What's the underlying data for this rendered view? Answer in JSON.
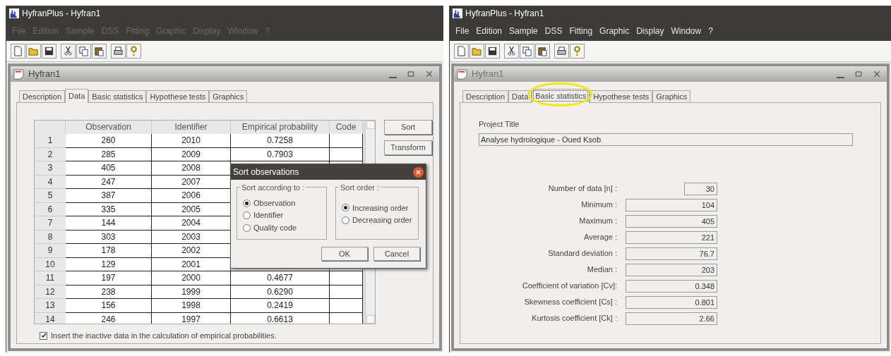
{
  "windows": [
    {
      "title": "HyfranPlus - Hyfran1",
      "menu": [
        {
          "label": "File",
          "disabled": true
        },
        {
          "label": "Edition",
          "disabled": true
        },
        {
          "label": "Sample",
          "disabled": true
        },
        {
          "label": "DSS",
          "disabled": true
        },
        {
          "label": "Fitting",
          "disabled": true
        },
        {
          "label": "Graphic",
          "disabled": true
        },
        {
          "label": "Display",
          "disabled": true
        },
        {
          "label": "Window",
          "disabled": true
        },
        {
          "label": "?",
          "disabled": true
        }
      ],
      "child_window": {
        "title": "Hyfran1",
        "active": true
      },
      "tabs": [
        {
          "label": "Description",
          "selected": false,
          "highlighted": false
        },
        {
          "label": "Data",
          "selected": true,
          "highlighted": false
        },
        {
          "label": "Basic statistics",
          "selected": false,
          "highlighted": false
        },
        {
          "label": "Hypothese tests",
          "selected": false,
          "highlighted": false
        },
        {
          "label": "Graphics",
          "selected": false,
          "highlighted": false
        }
      ],
      "content": {
        "kind": "data",
        "table": {
          "columns": [
            "Observation",
            "Identifier",
            "Empirical probability",
            "Code"
          ],
          "rows": [
            {
              "number": "1",
              "observation": "260",
              "identifier": "2010",
              "probability": "0.7258"
            },
            {
              "number": "2",
              "observation": "285",
              "identifier": "2009",
              "probability": "0.7903"
            },
            {
              "number": "3",
              "observation": "405",
              "identifier": "2008"
            },
            {
              "number": "4",
              "observation": "247",
              "identifier": "2007"
            },
            {
              "number": "5",
              "observation": "387",
              "identifier": "2006"
            },
            {
              "number": "6",
              "observation": "335",
              "identifier": "2005"
            },
            {
              "number": "7",
              "observation": "144",
              "identifier": "2004"
            },
            {
              "number": "8",
              "observation": "303",
              "identifier": "2003"
            },
            {
              "number": "9",
              "observation": "178",
              "identifier": "2002"
            },
            {
              "number": "10",
              "observation": "129",
              "identifier": "2001"
            },
            {
              "number": "11",
              "observation": "197",
              "identifier": "2000",
              "probability": "0.4677"
            },
            {
              "number": "12",
              "observation": "238",
              "identifier": "1999",
              "probability": "0.6290"
            },
            {
              "number": "13",
              "observation": "156",
              "identifier": "1998",
              "probability": "0.2419"
            },
            {
              "number": "14",
              "observation": "246",
              "identifier": "1997",
              "probability": "0.6613"
            }
          ]
        },
        "buttons": [
          "Sort",
          "Transform"
        ],
        "checkbox": {
          "label": "Insert the inactive data in the calculation of empirical probabilities.",
          "checked": true
        },
        "dialog": {
          "title": "Sort observations",
          "groups": [
            {
              "title": "Sort according to :",
              "options": [
                {
                  "label": "Observation",
                  "selected": true
                },
                {
                  "label": "Identifier",
                  "selected": false
                },
                {
                  "label": "Quality code",
                  "selected": false
                }
              ]
            },
            {
              "title": "Sort order :",
              "options": [
                {
                  "label": "Increasing order",
                  "selected": true
                },
                {
                  "label": "Decreasing order",
                  "selected": false
                }
              ]
            }
          ],
          "buttons": [
            "OK",
            "Cancel"
          ]
        }
      }
    },
    {
      "title": "HyfranPlus - Hyfran1",
      "menu": [
        {
          "label": "File",
          "disabled": false
        },
        {
          "label": "Edition",
          "disabled": false
        },
        {
          "label": "Sample",
          "disabled": false
        },
        {
          "label": "DSS",
          "disabled": false
        },
        {
          "label": "Fitting",
          "disabled": false
        },
        {
          "label": "Graphic",
          "disabled": false
        },
        {
          "label": "Display",
          "disabled": false
        },
        {
          "label": "Window",
          "disabled": false
        },
        {
          "label": "?",
          "disabled": false
        }
      ],
      "child_window": {
        "title": "Hyfran1",
        "active": false
      },
      "tabs": [
        {
          "label": "Description",
          "selected": false,
          "highlighted": false
        },
        {
          "label": "Data",
          "selected": false,
          "highlighted": false
        },
        {
          "label": "Basic statistics",
          "selected": true,
          "highlighted": true
        },
        {
          "label": "Hypothese tests",
          "selected": false,
          "highlighted": false
        },
        {
          "label": "Graphics",
          "selected": false,
          "highlighted": false
        }
      ],
      "content": {
        "kind": "stats",
        "project_title_label": "Project Title",
        "project_title": "Analyse hydrologique - Oued Ksob",
        "stats": [
          {
            "label": "Number of data [n] :",
            "value": "30",
            "kind": "short"
          },
          {
            "label": "Minimum :",
            "value": "104",
            "kind": "wide"
          },
          {
            "label": "Maximum :",
            "value": "405",
            "kind": "wide"
          },
          {
            "label": "Average :",
            "value": "221",
            "kind": "wide"
          },
          {
            "label": "Standard deviation :",
            "value": "76.7",
            "kind": "wide"
          },
          {
            "label": "Median :",
            "value": "203",
            "kind": "wide"
          },
          {
            "label": "Coefficient of variation [Cv]:",
            "value": "0.348",
            "kind": "wide"
          },
          {
            "label": "Skewness coefficient [Cs] :",
            "value": "0.801",
            "kind": "wide"
          },
          {
            "label": "Kurtosis coefficient [Ck] :",
            "value": "2.66",
            "kind": "wide"
          }
        ]
      }
    }
  ]
}
